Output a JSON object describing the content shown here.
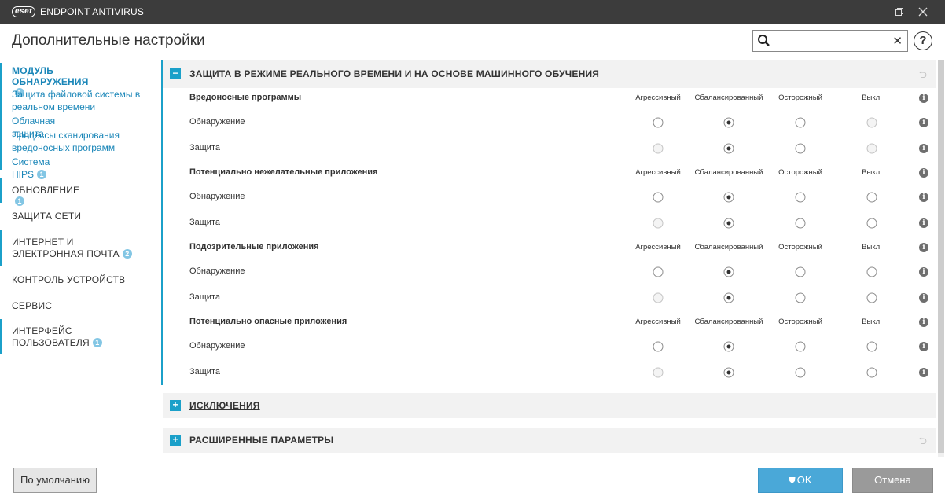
{
  "window": {
    "logo": "eset",
    "title": "ENDPOINT ANTIVIRUS",
    "restore_icon": "restore-icon",
    "close_icon": "close-icon"
  },
  "header": {
    "title": "Дополнительные настройки",
    "search": {
      "value": "",
      "placeholder": ""
    },
    "help_label": "?"
  },
  "sidebar": {
    "detection": {
      "label": "МОДУЛЬ ОБНАРУЖЕНИЯ",
      "badge": "1",
      "sub": [
        {
          "label": "Защита файловой системы в реальном времени"
        },
        {
          "label": "Облачная защита"
        },
        {
          "label": "Процессы сканирования вредоносных программ"
        },
        {
          "label": "Система HIPS",
          "badge": "1"
        }
      ]
    },
    "update": {
      "label": "ОБНОВЛЕНИЕ",
      "badge": "1"
    },
    "network": {
      "label": "ЗАЩИТА СЕТИ"
    },
    "web": {
      "label": "ИНТЕРНЕТ И ЭЛЕКТРОННАЯ ПОЧТА",
      "badge": "2"
    },
    "device": {
      "label": "КОНТРОЛЬ УСТРОЙСТВ"
    },
    "service": {
      "label": "СЕРВИС"
    },
    "ui": {
      "label": "ИНТЕРФЕЙС ПОЛЬЗОВАТЕЛЯ",
      "badge": "1"
    }
  },
  "main": {
    "realtime": {
      "title": "ЗАЩИТА В РЕЖИМЕ РЕАЛЬНОГО ВРЕМЕНИ И НА ОСНОВЕ МАШИННОГО ОБУЧЕНИЯ",
      "expanded": true,
      "columns": [
        "Агрессивный",
        "Сбалансированный",
        "Осторожный",
        "Выкл."
      ],
      "groups": [
        {
          "title": "Вредоносные программы",
          "rows": [
            {
              "label": "Обнаружение",
              "selected": 1,
              "disabled": [
                3
              ]
            },
            {
              "label": "Защита",
              "selected": 1,
              "disabled": [
                0,
                3
              ]
            }
          ]
        },
        {
          "title": "Потенциально нежелательные приложения",
          "rows": [
            {
              "label": "Обнаружение",
              "selected": 1,
              "disabled": []
            },
            {
              "label": "Защита",
              "selected": 1,
              "disabled": [
                0
              ]
            }
          ]
        },
        {
          "title": "Подозрительные приложения",
          "rows": [
            {
              "label": "Обнаружение",
              "selected": 1,
              "disabled": []
            },
            {
              "label": "Защита",
              "selected": 1,
              "disabled": [
                0
              ]
            }
          ]
        },
        {
          "title": "Потенциально опасные приложения",
          "rows": [
            {
              "label": "Обнаружение",
              "selected": 1,
              "disabled": []
            },
            {
              "label": "Защита",
              "selected": 1,
              "disabled": [
                0
              ]
            }
          ]
        }
      ]
    },
    "exclusions": {
      "title": "ИСКЛЮЧЕНИЯ",
      "expanded": false
    },
    "advanced": {
      "title": "РАСШИРЕННЫЕ ПАРАМЕТРЫ",
      "expanded": false
    }
  },
  "footer": {
    "default_label": "По умолчанию",
    "ok_label": "OK",
    "cancel_label": "Отмена"
  },
  "colors": {
    "accent": "#1ba0c9",
    "titlebar": "#3c3c3c",
    "ok": "#4aa8d8",
    "cancel": "#9a9a9a"
  }
}
